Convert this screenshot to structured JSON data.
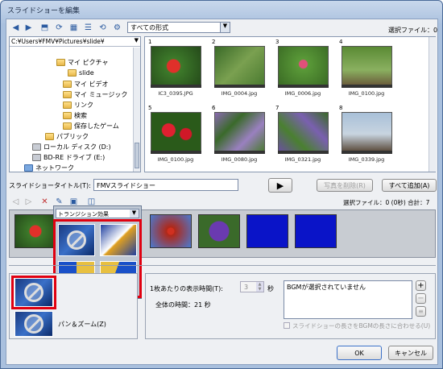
{
  "window": {
    "title": "スライドショーを編集"
  },
  "toolbar": {
    "format_select": "すべての形式",
    "selected_files_top": "選択ファイル：0"
  },
  "tree": {
    "path": "C:¥Users¥FMV¥Pictures¥slide¥",
    "items": [
      {
        "label": "マイ ピクチャ"
      },
      {
        "label": "slide"
      },
      {
        "label": "マイ ビデオ"
      },
      {
        "label": "マイ ミュージック"
      },
      {
        "label": "リンク"
      },
      {
        "label": "検索"
      },
      {
        "label": "保存したゲーム"
      },
      {
        "label": "パブリック"
      },
      {
        "label": "ローカル ディスク (D:)"
      },
      {
        "label": "BD-RE ドライブ (E:)"
      },
      {
        "label": "ネットワーク"
      }
    ]
  },
  "thumbnails": [
    {
      "num": "1",
      "caption": "IC3_0395.JPG"
    },
    {
      "num": "2",
      "caption": "IMG_0004.jpg"
    },
    {
      "num": "3",
      "caption": "IMG_0006.jpg"
    },
    {
      "num": "4",
      "caption": "IMG_0100.jpg"
    },
    {
      "num": "5",
      "caption": "IMG_0100.jpg"
    },
    {
      "num": "6",
      "caption": "IMG_0080.jpg"
    },
    {
      "num": "7",
      "caption": "IMG_0321.jpg"
    },
    {
      "num": "8",
      "caption": "IMG_0339.jpg"
    }
  ],
  "slideshow": {
    "title_label": "スライドショータイトル(T):",
    "title_value": "FMVスライドショー",
    "remove_button": "写真を削除(R)",
    "add_all_button": "すべて追加(A)",
    "selected_status": "選択ファイル：0 (0秒) 合計：7"
  },
  "transition": {
    "select_label": "トランジション効果"
  },
  "effects": {
    "pan_zoom_label": "パン＆ズーム(Z)"
  },
  "timing": {
    "per_image_label": "1枚あたりの表示時間(T):",
    "per_image_value": "3",
    "seconds_unit": "秒",
    "total_time": "全体の時間：21 秒"
  },
  "bgm": {
    "status": "BGMが選択されていません",
    "fit_checkbox_label": "スライドショーの長さをBGMの長さに合わせる(U)"
  },
  "footer": {
    "ok_button": "OK",
    "cancel_button": "キャンセル"
  }
}
